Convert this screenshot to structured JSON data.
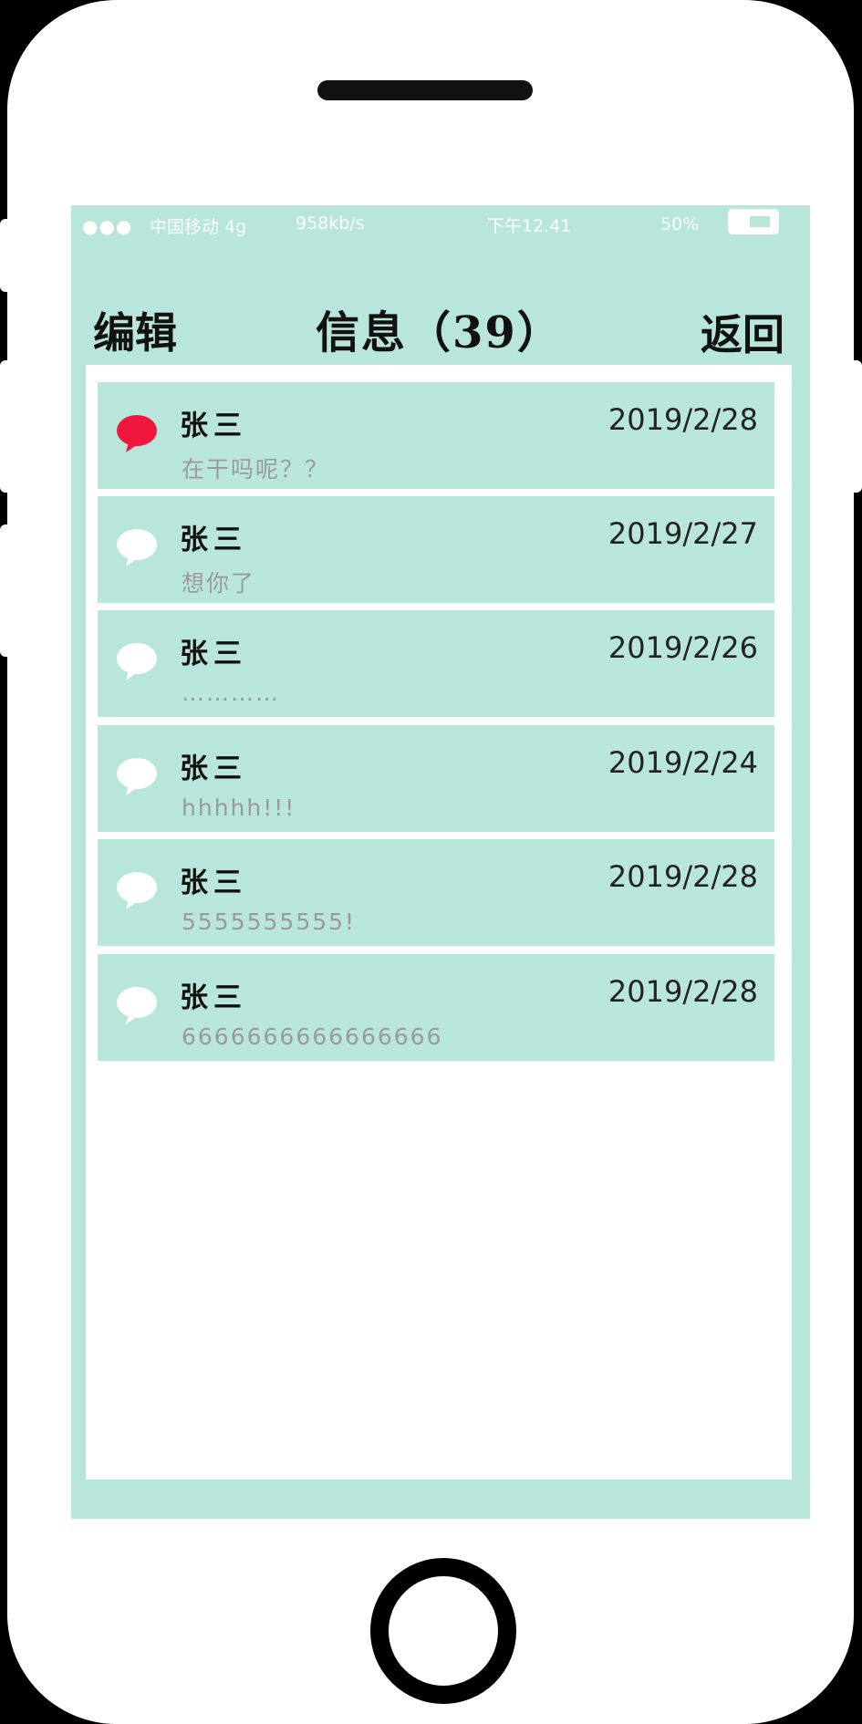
{
  "status_bar": {
    "signal_dots": "●●●",
    "carrier": "中国移动 4g",
    "speed": "958kb/s",
    "time": "下午12.41",
    "battery_percent": "50%"
  },
  "header": {
    "edit_label": "编辑",
    "title": "信息（39）",
    "back_label": "返回"
  },
  "messages": [
    {
      "name": "张三",
      "date": "2019/2/28",
      "preview": "在干吗呢？？",
      "unread": true
    },
    {
      "name": "张三",
      "date": "2019/2/27",
      "preview": "想你了",
      "unread": false
    },
    {
      "name": "张三",
      "date": "2019/2/26",
      "preview": "…………",
      "unread": false
    },
    {
      "name": "张三",
      "date": "2019/2/24",
      "preview": "hhhhh!!!",
      "unread": false
    },
    {
      "name": "张三",
      "date": "2019/2/28",
      "preview": "5555555555!",
      "unread": false
    },
    {
      "name": "张三",
      "date": "2019/2/28",
      "preview": "6666666666666666",
      "unread": false
    }
  ],
  "colors": {
    "screen_bg": "#b9e6da",
    "unread_bubble": "#f0173c",
    "read_bubble": "#ffffff"
  },
  "icons": {
    "message_bubble": "speech-bubble-icon",
    "battery": "battery-icon"
  }
}
